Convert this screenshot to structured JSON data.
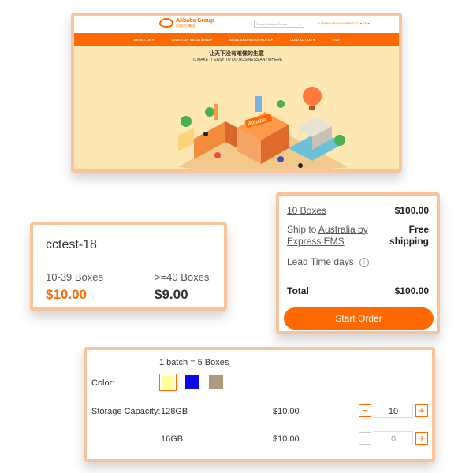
{
  "site": {
    "logo_text": "Alibaba Group",
    "logo_sub": "阿里巴巴集团",
    "search_placeholder": "Search Alibaba Group",
    "top_nav_item": "ALIBABA GROUP WEBSITES ▾",
    "language": "EN ▾",
    "nav": [
      "ABOUT US ▾",
      "INVESTOR RELATIONS ▾",
      "NEWS AND RESOURCES ▾",
      "CONTACT US ▾",
      "ESG"
    ],
    "hero_cn": "让天下没有难做的生意",
    "hero_en": "TO MAKE IT EASY TO DO BUSINESS ANYWHERE",
    "sign_text": "Alibaba"
  },
  "price_card": {
    "title": "cctest-18",
    "tiers": [
      {
        "range": "10-39 Boxes",
        "price": "$10.00"
      },
      {
        "range": ">=40 Boxes",
        "price": "$9.00"
      }
    ]
  },
  "order": {
    "quantity_link": "10 Boxes",
    "quantity_price": "$100.00",
    "ship_prefix": "Ship to ",
    "ship_country": "Australia by",
    "ship_method": "Express EMS",
    "shipping_line1": "Free",
    "shipping_line2": "shipping",
    "lead_time": "Lead Time days",
    "info_icon": "i",
    "total_label": "Total",
    "total_value": "$100.00",
    "button": "Start Order"
  },
  "variant": {
    "batch_note": "1 batch = 5 Boxes",
    "color_label": "Color:",
    "colors": [
      "#ffff99",
      "#0a0ae6",
      "#b09a80"
    ],
    "storage_label": "Storage Capacity:",
    "rows": [
      {
        "capacity": "128GB",
        "price": "$10.00",
        "qty": "10"
      },
      {
        "capacity": "16GB",
        "price": "$10.00",
        "qty": "0"
      }
    ],
    "minus": "−",
    "plus": "+"
  }
}
